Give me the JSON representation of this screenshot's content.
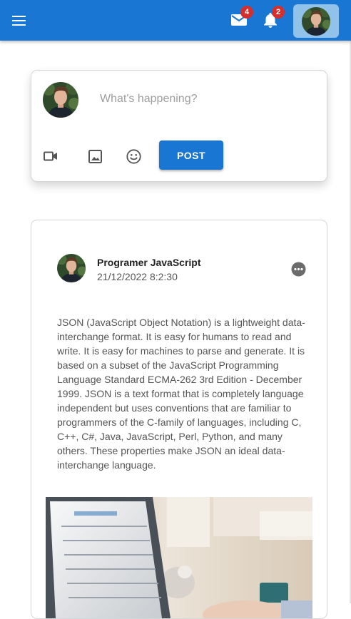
{
  "app_bar": {
    "menu_icon": "menu-icon",
    "mail": {
      "icon": "mail-icon",
      "badge": "4"
    },
    "notifications": {
      "icon": "bell-icon",
      "badge": "2"
    },
    "profile_icon": "avatar"
  },
  "composer": {
    "placeholder": "What's happening?",
    "tools": [
      "video-icon",
      "image-icon",
      "emoji-icon"
    ],
    "post_label": "POST"
  },
  "post": {
    "author": "Programer JavaScript",
    "timestamp": "21/12/2022 8:2:30",
    "more_icon": "more-horizontal-icon",
    "body": "JSON (JavaScript Object Notation) is a lightweight data-interchange format. It is easy for humans to read and write. It is easy for machines to parse and generate. It is based on a subset of the JavaScript Programming Language Standard ECMA-262 3rd Edition - December 1999. JSON is a text format that is completely language independent but uses conventions that are familiar to programmers of the C-family of languages, including C, C++, C#, Java, JavaScript, Perl, Python, and many others. These properties make JSON an ideal data-interchange language."
  },
  "colors": {
    "primary": "#1976d2",
    "badge": "#d32f2f",
    "profile_button": "#90c2ea"
  }
}
